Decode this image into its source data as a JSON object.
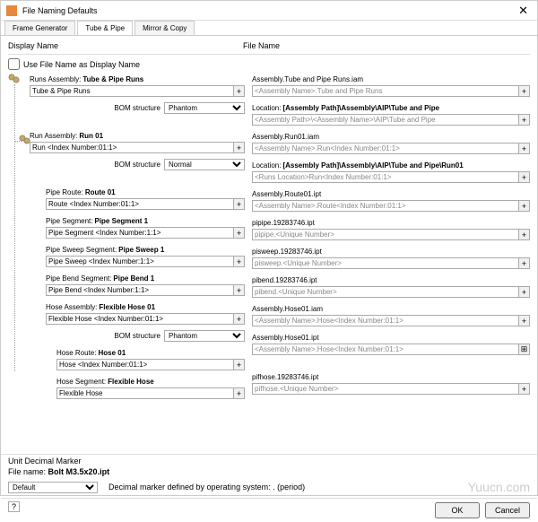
{
  "title": "File Naming Defaults",
  "tabs": [
    "Frame Generator",
    "Tube & Pipe",
    "Mirror & Copy"
  ],
  "activeTab": 1,
  "displayNameHeader": "Display Name",
  "fileNameHeader": "File Name",
  "useFileNameChk": "Use File Name as Display Name",
  "bomLabel": "BOM structure",
  "bomPhantom": "Phantom",
  "bomNormal": "Normal",
  "items": {
    "runsAsm": {
      "lbl": "Runs Assembly:",
      "val": "Tube & Pipe Runs",
      "input": "Tube & Pipe Runs",
      "fnlbl": "Assembly.Tube and Pipe Runs.iam",
      "fninput": "<Assembly Name>.Tube and Pipe Runs"
    },
    "loc1": {
      "lbl": "Location:",
      "val": "[Assembly Path]\\Assembly\\AIP\\Tube and Pipe",
      "input": "<Assembly Path>\\<Assembly Name>\\AIP\\Tube and Pipe"
    },
    "runAsm": {
      "lbl": "Run Assembly:",
      "val": "Run 01",
      "input": "Run <Index Number:01:1>",
      "fnlbl": "Assembly.Run01.iam",
      "fninput": "<Assembly Name>.Run<Index Number:01:1>"
    },
    "loc2": {
      "lbl": "Location:",
      "val": "[Assembly Path]\\Assembly\\AIP\\Tube and Pipe\\Run01",
      "input": "<Runs Location>Run<Index Number:01:1>"
    },
    "pipeRoute": {
      "lbl": "Pipe Route:",
      "val": "Route 01",
      "input": "Route <Index Number:01:1>",
      "fnlbl": "Assembly.Route01.ipt",
      "fninput": "<Assembly Name>.Route<Index Number:01:1>"
    },
    "pipeSeg": {
      "lbl": "Pipe Segment:",
      "val": "Pipe Segment 1",
      "input": "Pipe Segment <Index Number:1:1>",
      "fnlbl": "pipipe.19283746.ipt",
      "fninput": "pipipe.<Unique Number>"
    },
    "pipeSweep": {
      "lbl": "Pipe Sweep Segment:",
      "val": "Pipe Sweep 1",
      "input": "Pipe Sweep <Index Number:1:1>",
      "fnlbl": "pisweep.19283746.ipt",
      "fninput": "pisweep.<Unique Number>"
    },
    "pipeBend": {
      "lbl": "Pipe Bend Segment:",
      "val": "Pipe Bend 1",
      "input": "Pipe Bend <Index Number:1:1>",
      "fnlbl": "pibend.19283746.ipt",
      "fninput": "pibend.<Unique Number>"
    },
    "hoseAsm": {
      "lbl": "Hose Assembly:",
      "val": "Flexible Hose 01",
      "input": "Flexible Hose <Index Number:01:1>",
      "fnlbl": "Assembly.Hose01.iam",
      "fninput": "<Assembly Name>.Hose<Index Number:01:1>"
    },
    "hoseAsm2": {
      "fnlbl": "Assembly.Hose01.ipt",
      "fninput": "<Assembly Name>.Hose<Index Number:01:1>"
    },
    "hoseRoute": {
      "lbl": "Hose Route:",
      "val": "Hose 01",
      "input": "Hose <Index Number:01:1>"
    },
    "hoseSeg": {
      "lbl": "Hose Segment:",
      "val": "Flexible Hose",
      "input": "Flexible Hose",
      "fnlbl": "pifhose.19283746.ipt",
      "fninput": "pifhose.<Unique Number>"
    }
  },
  "decimalSection": "Unit Decimal Marker",
  "fileNameExample": "File name:",
  "fileNameExampleVal": "Bolt M3.5x20.ipt",
  "decimalDefault": "Default",
  "decimalNote": "Decimal marker defined by operating system: . (period)",
  "ok": "OK",
  "cancel": "Cancel",
  "watermark": "Yuucn.com"
}
